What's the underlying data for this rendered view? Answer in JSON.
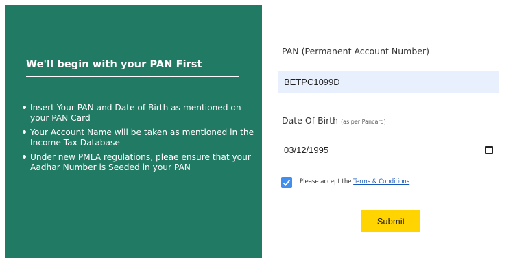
{
  "left_panel": {
    "title": "We'll begin with your PAN First",
    "bullets": [
      "Insert Your PAN and Date of Birth as mentioned on your PAN Card",
      "Your Account Name will be taken as mentioned in the Income Tax Database",
      "Under new PMLA regulations, pleae ensure that your Aadhar Number is Seeded in your PAN"
    ]
  },
  "form": {
    "pan_label": "PAN (Permanent Account Number)",
    "pan_value": "BETPC1099D",
    "dob_label": "Date Of Birth",
    "dob_hint": "(as per Pancard)",
    "dob_value": "03/12/1995",
    "terms_prefix": "Please accept the",
    "terms_link": "Terms & Conditions",
    "terms_checked": true,
    "submit_label": "Submit"
  },
  "colors": {
    "panel_bg": "#217a63",
    "input_autofill_bg": "#e8f0fe",
    "checkbox_blue": "#3f8ef0",
    "submit_yellow": "#ffd400",
    "link_blue": "#1a57b8"
  }
}
